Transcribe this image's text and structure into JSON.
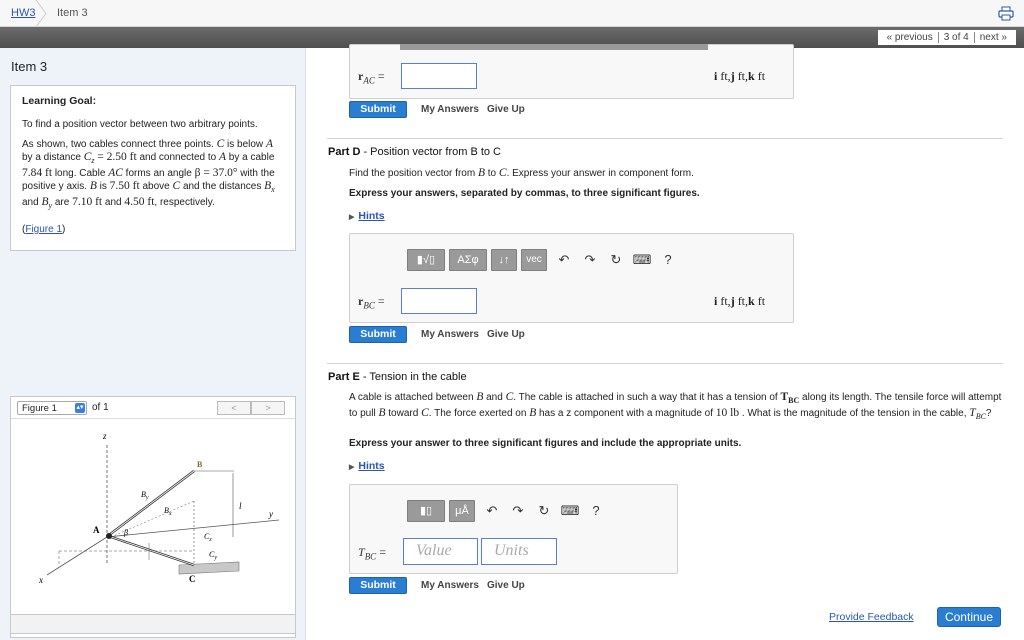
{
  "breadcrumb": {
    "hw": "HW3",
    "item": "Item 3"
  },
  "pager": {
    "previous": "« previous",
    "position": "3 of 4",
    "next": "next »"
  },
  "left": {
    "title": "Item 3",
    "goal_heading": "Learning Goal:",
    "goal_text": "To find a position vector between two arbitrary points.",
    "problem": {
      "p1": "As shown, two cables connect three points.",
      "c": "C",
      "p2": "is below",
      "a": "A",
      "p3": "by a distance",
      "cz": "C",
      "cz_sub": "z",
      "cz_val": "= 2.50 ft",
      "p4": "and connected to",
      "a2": "A",
      "p5": "by a cable",
      "len": "7.84 ft",
      "p6": "long. Cable",
      "ac": "AC",
      "p7": "forms an angle",
      "beta": "β = 37.0°",
      "p8": "with the positive y axis.",
      "b": "B",
      "p9": "is",
      "bz": "7.50 ft",
      "p10": "above",
      "c2": "C",
      "p11": "and the distances",
      "bx": "B",
      "bx_sub": "x",
      "p12": "and",
      "by": "B",
      "by_sub": "y",
      "p13": "are",
      "bxv": "7.10 ft",
      "p14": "and",
      "byv": "4.50 ft",
      "p15": ", respectively."
    },
    "figure_link": "Figure 1",
    "figure_select": "Figure 1",
    "figure_of": "of 1",
    "figure_prev": "<",
    "figure_next": ">",
    "fig_labels": {
      "z": "z",
      "y": "y",
      "x": "x",
      "A": "A",
      "B": "B",
      "C": "C",
      "By": "B",
      "By_sub": "y",
      "Bx": "B",
      "Bx_sub": "x",
      "beta": "β",
      "Cz": "C",
      "Cz_sub": "z",
      "Cy": "C",
      "Cy_sub": "y",
      "l": "l"
    }
  },
  "partC": {
    "label": "r",
    "sub": "AC",
    "eq": "=",
    "units": [
      "i",
      " ft,",
      "j",
      " ft,",
      "k",
      " ft"
    ],
    "submit": "Submit",
    "my_answers": "My Answers",
    "give_up": "Give Up"
  },
  "partD": {
    "title_bold": "Part D",
    "title_rest": " - Position vector from B to C",
    "instr_a": "Find the position vector from",
    "b": "B",
    "to": "to",
    "c": "C",
    "instr_b": ". Express your answer in component form.",
    "bold": "Express your answers, separated by commas, to three significant figures.",
    "hints": "Hints",
    "toolbar": {
      "templates": "▮√▯",
      "greek": "ΑΣφ",
      "sort": "↓↑",
      "vec": "vec",
      "help": "?"
    },
    "label": "r",
    "sub": "BC",
    "eq": "=",
    "units": [
      "i",
      " ft,",
      "j",
      " ft,",
      "k",
      " ft"
    ],
    "submit": "Submit",
    "my_answers": "My Answers",
    "give_up": "Give Up"
  },
  "partE": {
    "title_bold": "Part E",
    "title_rest": " - Tension in the cable",
    "l1_a": "A cable is attached between",
    "b": "B",
    "and": "and",
    "c": "C",
    "l1_b": ". The cable is attached in such a way that it has a tension of",
    "tbc": "T",
    "tbc_sub": "BC",
    "l1_c": "along its length. The tensile force",
    "l2_a": "will attempt to pull",
    "b2": "B",
    "toward": "toward",
    "c2": "C",
    "l2_b": ". The force exerted on",
    "b3": "B",
    "l2_c": "has a z component with a magnitude of",
    "mag": "10 lb",
    "l2_d": ". What is the magnitude of the tension",
    "l3_a": "in the cable,",
    "t2": "T",
    "t2_sub": "BC",
    "l3_b": "?",
    "bold": "Express your answer to three significant figures and include the appropriate units.",
    "hints": "Hints",
    "toolbar": {
      "templates": "▮▯",
      "mu": "μÅ",
      "help": "?"
    },
    "label": "T",
    "sub": "BC",
    "eq": "=",
    "value_placeholder": "Value",
    "units_placeholder": "Units",
    "submit": "Submit",
    "my_answers": "My Answers",
    "give_up": "Give Up"
  },
  "footer": {
    "feedback": "Provide Feedback",
    "continue": "Continue"
  }
}
